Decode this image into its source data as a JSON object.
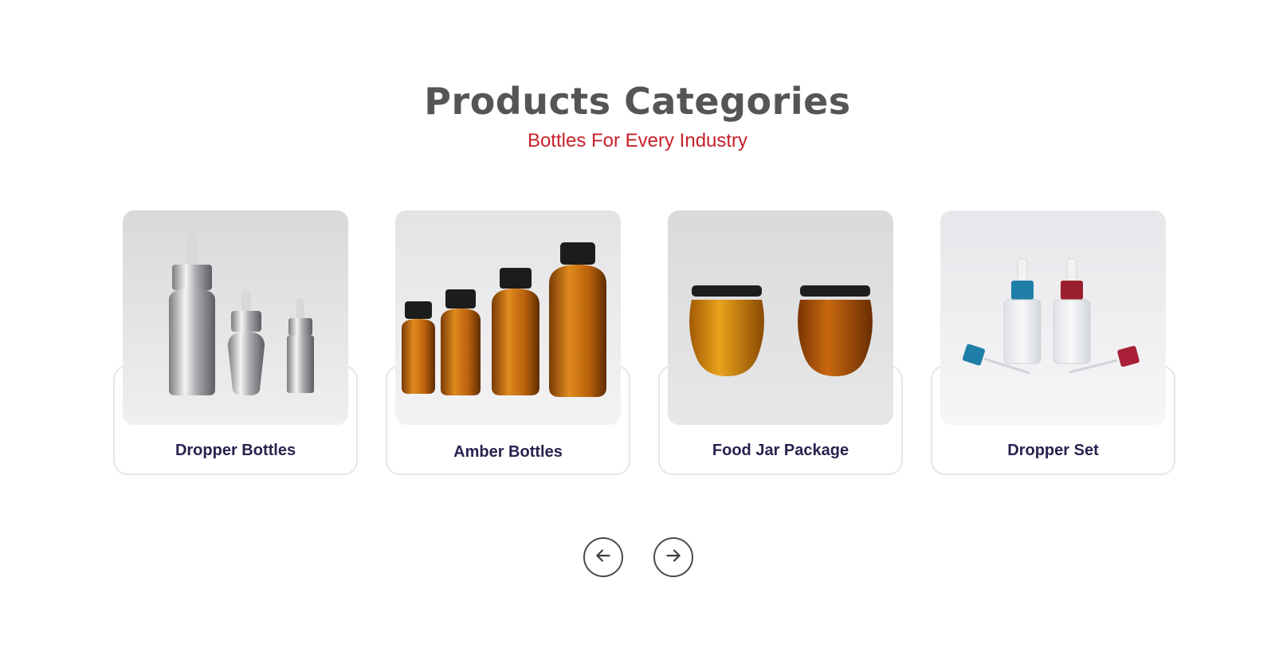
{
  "section": {
    "title": "Products Categories",
    "subtitle": "Bottles For Every Industry"
  },
  "categories": [
    {
      "label": "Dropper Bottles",
      "image": "silver-dropper-bottles"
    },
    {
      "label": "Amber Bottles",
      "image": "amber-glass-bottles"
    },
    {
      "label": "Food Jar Package",
      "image": "honey-food-jars"
    },
    {
      "label": "Dropper Set",
      "image": "frosted-dropper-set"
    }
  ],
  "carousel": {
    "prev_icon": "arrow-left-icon",
    "next_icon": "arrow-right-icon"
  },
  "colors": {
    "title": "#555555",
    "subtitle": "#c8202b",
    "card_label": "#27234f",
    "card_border": "#e6e6ea"
  }
}
